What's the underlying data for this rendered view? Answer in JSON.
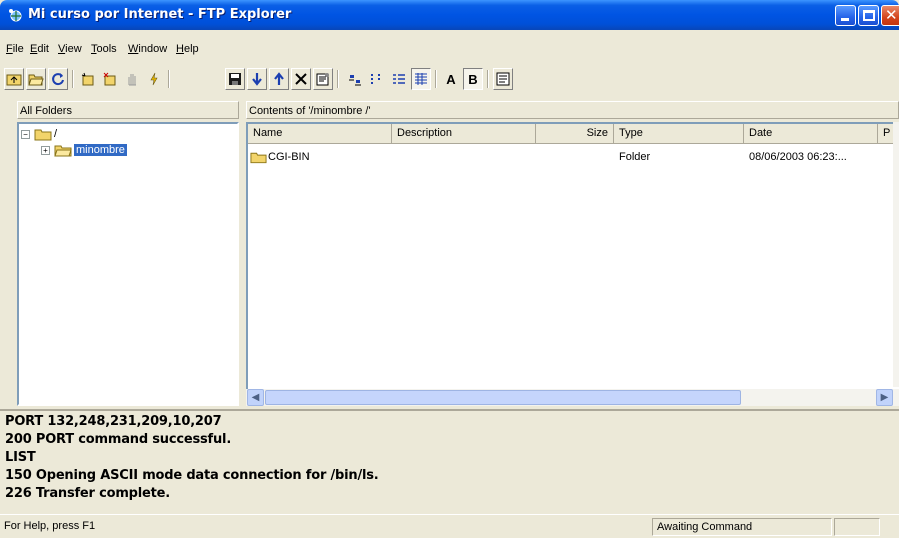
{
  "window": {
    "title": "Mi curso por Internet - FTP Explorer",
    "title_icon": "network-globe-icon"
  },
  "menu": [
    "File",
    "Edit",
    "View",
    "Tools",
    "Window",
    "Help"
  ],
  "toolbar": {
    "buttons": [
      "go-up-folder-icon",
      "open-folder-icon",
      "refresh-icon",
      "new-folder-icon",
      "delete-folder-icon",
      "stop-hand-icon",
      "lightning-icon",
      "save-icon",
      "download-arrow-icon",
      "upload-arrow-icon",
      "delete-x-icon",
      "properties-icon",
      "large-icons-view-icon",
      "small-icons-view-icon",
      "list-view-icon",
      "details-view-icon",
      "ascii-mode-icon",
      "binary-mode-icon",
      "log-window-icon"
    ],
    "ascii_label": "A",
    "binary_label": "B",
    "details_selected": true,
    "binary_selected": true
  },
  "left_pane": {
    "header": "All Folders",
    "tree": [
      {
        "label": "/",
        "expanded": true
      },
      {
        "label": "minombre",
        "selected": true
      }
    ]
  },
  "right_pane": {
    "header": "Contents of '/minombre /'",
    "columns": [
      "Name",
      "Description",
      "Size",
      "Type",
      "Date",
      "P"
    ],
    "rows": [
      {
        "name": "CGI-BIN",
        "description": "",
        "size": "",
        "type": "Folder",
        "date": "08/06/2003 06:23:..."
      }
    ]
  },
  "log": [
    "PORT 132,248,231,209,10,207",
    "200 PORT command successful.",
    "LIST",
    "150 Opening ASCII mode data connection for /bin/ls.",
    "226 Transfer complete."
  ],
  "status": {
    "help_text": "For Help, press F1",
    "state": "Awaiting Command"
  },
  "colors": {
    "title_blue": "#0054e3",
    "selection": "#316ac5",
    "folder_yellow": "#f2d46b",
    "face": "#ece9d8"
  }
}
